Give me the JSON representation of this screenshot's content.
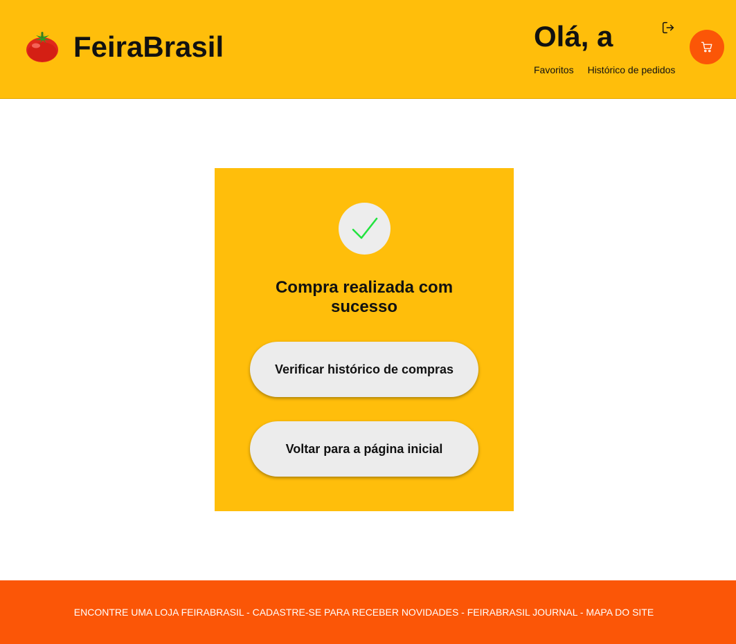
{
  "colors": {
    "primary_yellow": "#ffbe0b",
    "accent_orange": "#fb5607",
    "check_green": "#22e33f",
    "button_bg": "#ececec"
  },
  "header": {
    "brand_icon": "tomato-icon",
    "brand_name": "FeiraBrasil",
    "greeting": "Olá, a",
    "logout_icon": "logout-icon",
    "nav": {
      "favorites": "Favoritos",
      "order_history": "Histórico de pedidos"
    },
    "cart_icon": "shopping-cart-icon"
  },
  "success": {
    "icon": "checkmark-icon",
    "title": "Compra realizada com sucesso",
    "check_history_label": "Verificar histórico de compras",
    "back_home_label": "Voltar para a página inicial"
  },
  "footer": {
    "links": [
      "ENCONTRE UMA LOJA FEIRABRASIL",
      "CADASTRE-SE PARA RECEBER NOVIDADES",
      "FEIRABRASIL JOURNAL",
      "MAPA DO SITE"
    ],
    "separator": " - "
  }
}
